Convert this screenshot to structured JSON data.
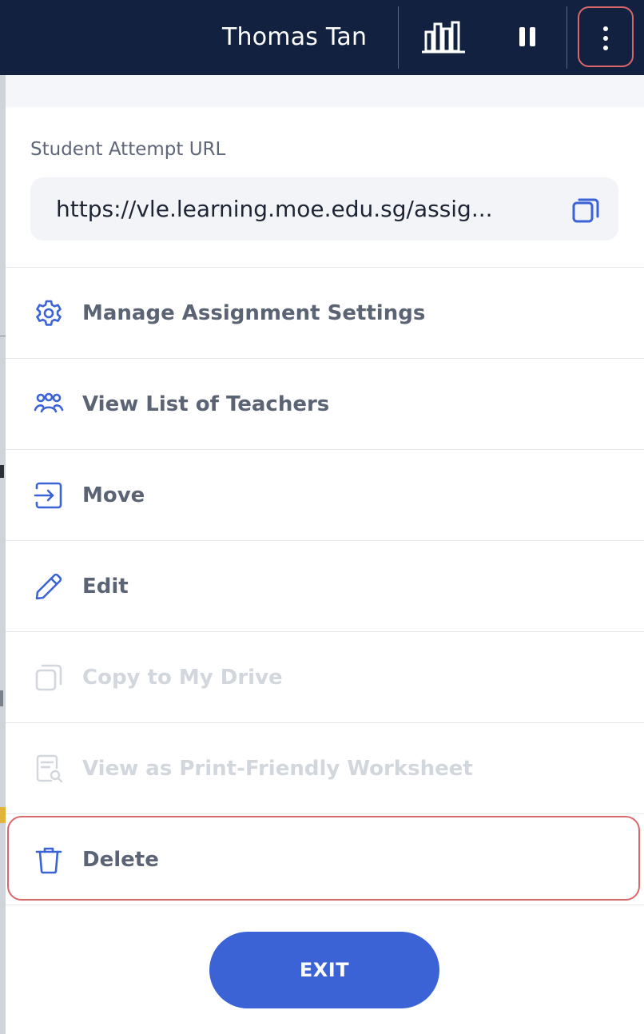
{
  "header": {
    "user_name": "Thomas Tan",
    "icons": {
      "stats": "bar-chart-icon",
      "pause": "pause-icon",
      "more": "more-vertical-icon"
    }
  },
  "panel": {
    "url_label": "Student Attempt URL",
    "url_value": "https://vle.learning.moe.edu.sg/assig...",
    "menu": [
      {
        "label": "Manage Assignment Settings",
        "icon": "gear-icon",
        "enabled": true
      },
      {
        "label": "View List of Teachers",
        "icon": "users-icon",
        "enabled": true
      },
      {
        "label": "Move",
        "icon": "move-icon",
        "enabled": true
      },
      {
        "label": "Edit",
        "icon": "pencil-icon",
        "enabled": true
      },
      {
        "label": "Copy to My Drive",
        "icon": "copy-icon",
        "enabled": false
      },
      {
        "label": "View as Print-Friendly Worksheet",
        "icon": "document-search-icon",
        "enabled": false
      },
      {
        "label": "Delete",
        "icon": "trash-icon",
        "enabled": true
      }
    ],
    "exit_label": "EXIT"
  },
  "colors": {
    "header_bg": "#11213f",
    "accent": "#3b63d6",
    "highlight": "#d9676a",
    "menu_text": "#5b6474",
    "disabled_text": "#d2d6dd"
  }
}
